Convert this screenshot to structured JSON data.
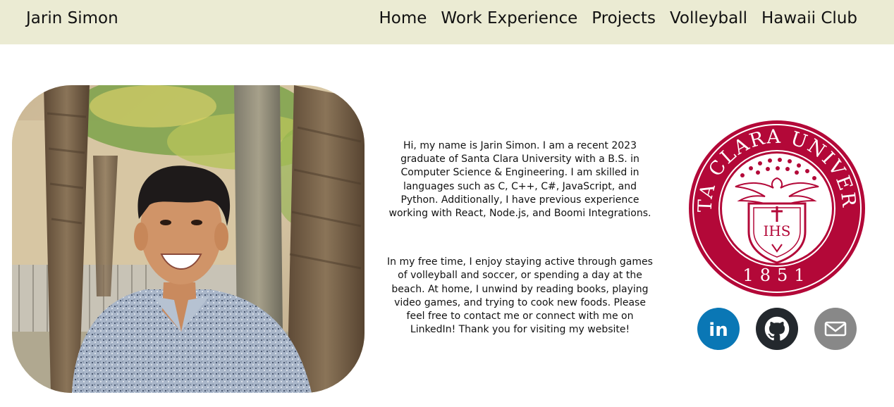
{
  "header": {
    "brand": "Jarin Simon",
    "nav": [
      "Home",
      "Work Experience",
      "Projects",
      "Volleyball",
      "Hawaii Club"
    ]
  },
  "about": {
    "paragraph_1": "Hi, my name is Jarin Simon. I am a recent 2023 graduate of Santa Clara University with a B.S. in Computer Science & Engineering. I am skilled in languages such as C, C++, C#, JavaScript, and Python. Additionally, I have previous experience working with React, Node.js, and Boomi Integrations.",
    "paragraph_2": "In my free time, I enjoy staying active through games of volleyball and soccer, or spending a day at the beach. At home, I unwind by reading books, playing video games, and trying to cook new foods. Please feel free to contact me or connect with me on LinkedIn! Thank you for visiting my website!"
  },
  "seal": {
    "name": "SANTA CLARA UNIVERSITY",
    "year": "1851",
    "monogram": "IHS",
    "color": "#b30838"
  },
  "socials": [
    {
      "icon": "linkedin-icon",
      "label": "in",
      "color": "#0a77b5"
    },
    {
      "icon": "github-icon",
      "color": "#23282d"
    },
    {
      "icon": "mail-icon",
      "color": "#888888"
    }
  ],
  "colors": {
    "navbar": "#ebebd3",
    "text": "#111111"
  }
}
